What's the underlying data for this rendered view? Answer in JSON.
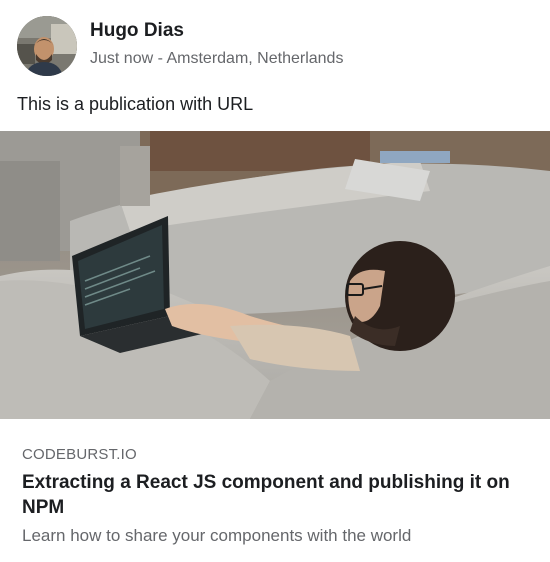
{
  "post": {
    "author": {
      "name": "Hugo Dias"
    },
    "meta": "Just now - Amsterdam, Netherlands",
    "text": "This is a publication with URL",
    "link": {
      "domain": "CODEBURST.IO",
      "title": "Extracting a React JS component and publishing it on NPM",
      "description": "Learn how to share your components with the world"
    }
  },
  "colors": {
    "primary_text": "#1c1e21",
    "secondary_text": "#65676b",
    "card_background": "#ffffff"
  }
}
